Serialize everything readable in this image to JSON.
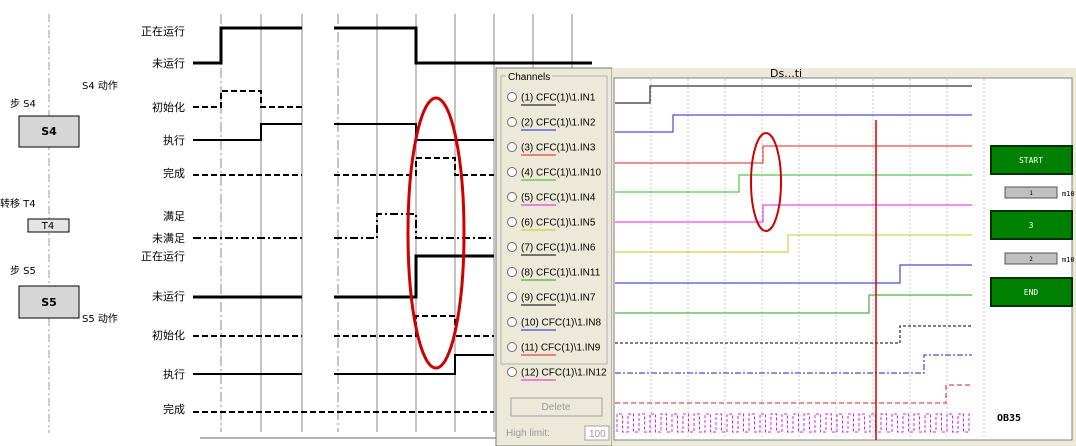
{
  "sfc": {
    "step_s4_label": "步 S4",
    "step_s4_box": "S4",
    "step_s4_action": "S4 动作",
    "trans_t4_label": "转移 T4",
    "trans_t4_box": "T4",
    "step_s5_label": "步 S5",
    "step_s5_box": "S5",
    "step_s5_action": "S5 动作"
  },
  "timing": {
    "labels": [
      "正在运行",
      "未运行",
      "初始化",
      "执行",
      "完成",
      "满足",
      "未满足",
      "正在运行",
      "未运行",
      "初始化",
      "执行",
      "完成"
    ]
  },
  "panel": {
    "channels_title": "Channels",
    "channels": [
      {
        "id": "(1)",
        "name": "CFC(1)\\1.IN1",
        "color": "#000000"
      },
      {
        "id": "(2)",
        "name": "CFC(1)\\1.IN2",
        "color": "#2020d0"
      },
      {
        "id": "(3)",
        "name": "CFC(1)\\1.IN3",
        "color": "#e02020"
      },
      {
        "id": "(4)",
        "name": "CFC(1)\\1.IN10",
        "color": "#20c020"
      },
      {
        "id": "(5)",
        "name": "CFC(1)\\1.IN4",
        "color": "#e020e0"
      },
      {
        "id": "(6)",
        "name": "CFC(1)\\1.IN5",
        "color": "#c8c820"
      },
      {
        "id": "(7)",
        "name": "CFC(1)\\1.IN6",
        "color": "#000000"
      },
      {
        "id": "(8)",
        "name": "CFC(1)\\1.IN11",
        "color": "#20a020"
      },
      {
        "id": "(9)",
        "name": "CFC(1)\\1.IN7",
        "color": "#000000"
      },
      {
        "id": "(10)",
        "name": "CFC(1)\\1.IN8",
        "color": "#2020d0"
      },
      {
        "id": "(11)",
        "name": "CFC(1)\\1.IN9",
        "color": "#e02020"
      },
      {
        "id": "(12)",
        "name": "CFC(1)\\1.IN12",
        "color": "#e020e0"
      }
    ],
    "delete_button": "Delete",
    "high_limit_label": "High limit:",
    "high_limit_value": "100",
    "top_header": "Ds...ti"
  },
  "graph": {
    "start": "START",
    "step3": "3",
    "end": "END",
    "t1": "1",
    "t2": "2",
    "ms1": "m10",
    "ms2": "m10",
    "ob": "OB35"
  }
}
